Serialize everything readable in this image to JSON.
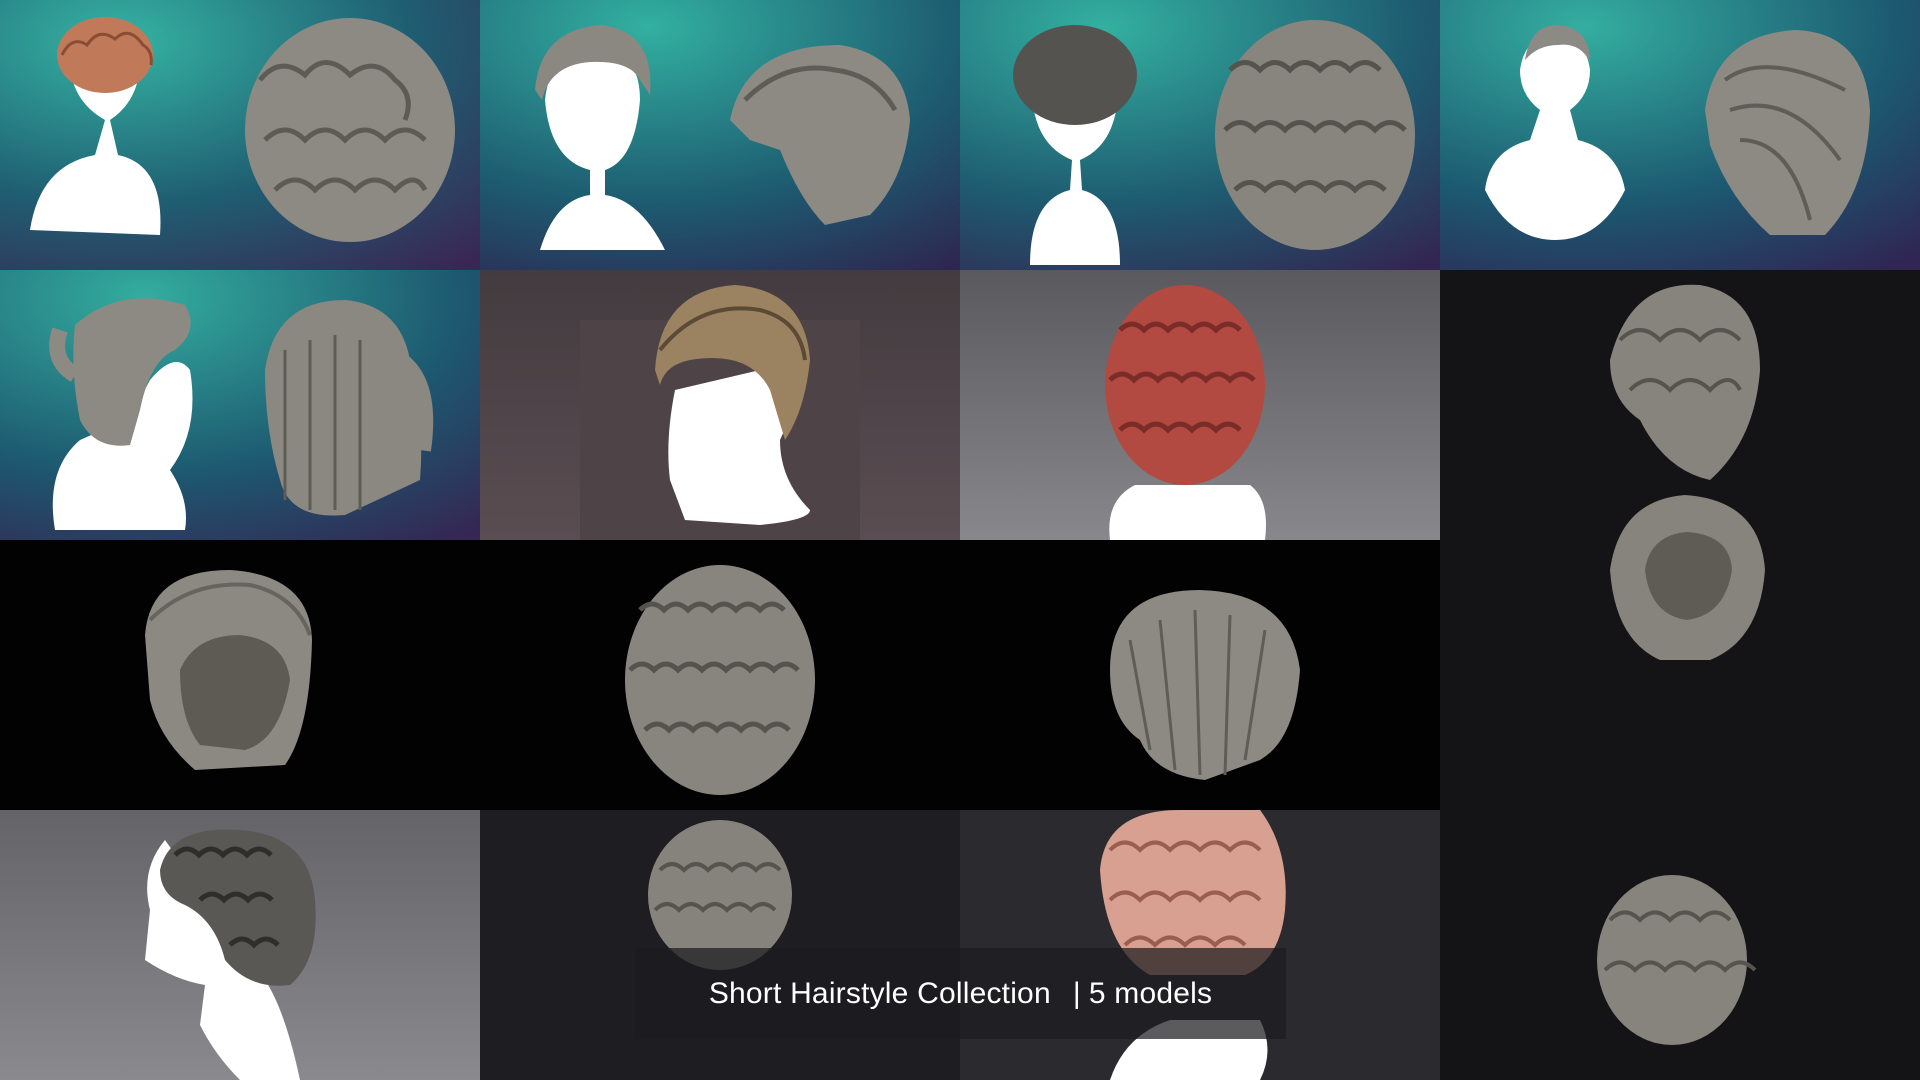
{
  "caption": {
    "title": "Short Hairstyle Collection",
    "count": "5 models"
  },
  "colors": {
    "teal_gradient_start": "#2ea89a",
    "teal_gradient_end": "#3c2a5c",
    "clay_gray": "#8c8a83",
    "copper_hair": "#c07a5a",
    "red_hair": "#b24a42",
    "pink_hair": "#d8a090",
    "silhouette_white": "#ffffff"
  },
  "tiles": [
    {
      "name": "curly-short-front-and-back",
      "background": "teal"
    },
    {
      "name": "swept-pompadour-front-and-back",
      "background": "teal"
    },
    {
      "name": "tight-curls-front-and-back",
      "background": "teal"
    },
    {
      "name": "side-part-front-and-back",
      "background": "teal"
    },
    {
      "name": "half-up-ponytail-side-and-back",
      "background": "teal"
    },
    {
      "name": "undercut-quiff-side",
      "background": "mauve"
    },
    {
      "name": "red-curls-back",
      "background": "gray"
    },
    {
      "name": "wavy-tousled-angle",
      "background": "charcoal"
    },
    {
      "name": "pompadour-shell-front",
      "background": "black"
    },
    {
      "name": "curly-shell-angle",
      "background": "black"
    },
    {
      "name": "bowl-cut-shell-back",
      "background": "black"
    },
    {
      "name": "wavy-shell-front",
      "background": "charcoal"
    },
    {
      "name": "curly-profile-side",
      "background": "gray"
    },
    {
      "name": "curly-shell-small",
      "background": "charcoal"
    },
    {
      "name": "pink-wavy-front",
      "background": "dark-gray"
    },
    {
      "name": "wavy-shell-back",
      "background": "charcoal"
    }
  ]
}
